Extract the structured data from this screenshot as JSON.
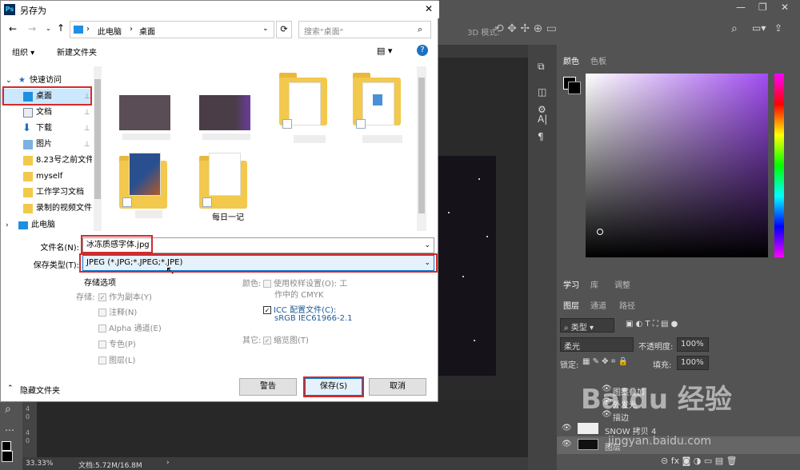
{
  "dialog": {
    "title": "另存为",
    "breadcrumb": [
      "此电脑",
      "桌面"
    ],
    "search_placeholder": "搜索\"桌面\"",
    "organize_label": "组织 ▾",
    "new_folder_label": "新建文件夹",
    "sidebar": [
      {
        "label": "快速访问",
        "icon": "star-icon"
      },
      {
        "label": "桌面",
        "icon": "desktop-icon",
        "selected": true
      },
      {
        "label": "文档",
        "icon": "document-icon"
      },
      {
        "label": "下载",
        "icon": "download-icon"
      },
      {
        "label": "图片",
        "icon": "picture-icon"
      },
      {
        "label": "8.23号之前文件",
        "icon": "folder-icon"
      },
      {
        "label": "myself",
        "icon": "folder-icon"
      },
      {
        "label": "工作学习文档",
        "icon": "folder-icon"
      },
      {
        "label": "录制的视频文件",
        "icon": "folder-icon"
      },
      {
        "label": "此电脑",
        "icon": "computer-icon"
      }
    ],
    "files": [
      {
        "label": ""
      },
      {
        "label": ""
      },
      {
        "label": ""
      },
      {
        "label": ""
      },
      {
        "label": ""
      },
      {
        "label": "每日一记"
      }
    ],
    "filename_label": "文件名(N):",
    "filename_value": "冰冻质感字体.jpg",
    "filetype_label": "保存类型(T):",
    "filetype_value": "JPEG (*.JPG;*.JPEG;*.JPE)",
    "storage_options_title": "存储选项",
    "storage_label": "存储:",
    "storage_options": [
      "作为副本(Y)",
      "注释(N)",
      "Alpha 通道(E)",
      "专色(P)",
      "图层(L)"
    ],
    "color_label": "颜色:",
    "color_proof": "使用校样设置(O): 工",
    "color_proof2": "作中的 CMYK",
    "icc_label": "ICC 配置文件(C):",
    "icc_value": "sRGB IEC61966-2.1",
    "other_label": "其它:",
    "thumbnail_label": "缩览图(T)",
    "hide_folders_label": "隐藏文件夹",
    "warning_button": "警告",
    "save_button": "保存(S)",
    "cancel_button": "取消"
  },
  "photoshop": {
    "mode_3d": "3D 模式:",
    "panel_tabs_color": [
      "颜色",
      "色板"
    ],
    "panel_tabs_learn": [
      "学习",
      "库",
      "调整"
    ],
    "panel_tabs_layers": [
      "图层",
      "通道",
      "路径"
    ],
    "layer_filter": "类型",
    "blend_mode": "柔光",
    "opacity_label": "不透明度:",
    "opacity_value": "100%",
    "lock_label": "锁定:",
    "fill_label": "填充:",
    "fill_value": "100%",
    "effects": [
      "图案叠加",
      "外发光",
      "描边"
    ],
    "layers": [
      "SNOW 拷贝 4",
      "图层"
    ],
    "zoom": "33.33%",
    "doc_size": "文档:5.72M/16.8M",
    "ruler_marks": [
      "4",
      "0",
      "4",
      "0"
    ]
  },
  "watermark": {
    "brand": "Baidu 经验",
    "url": "jingyan.baidu.com"
  }
}
